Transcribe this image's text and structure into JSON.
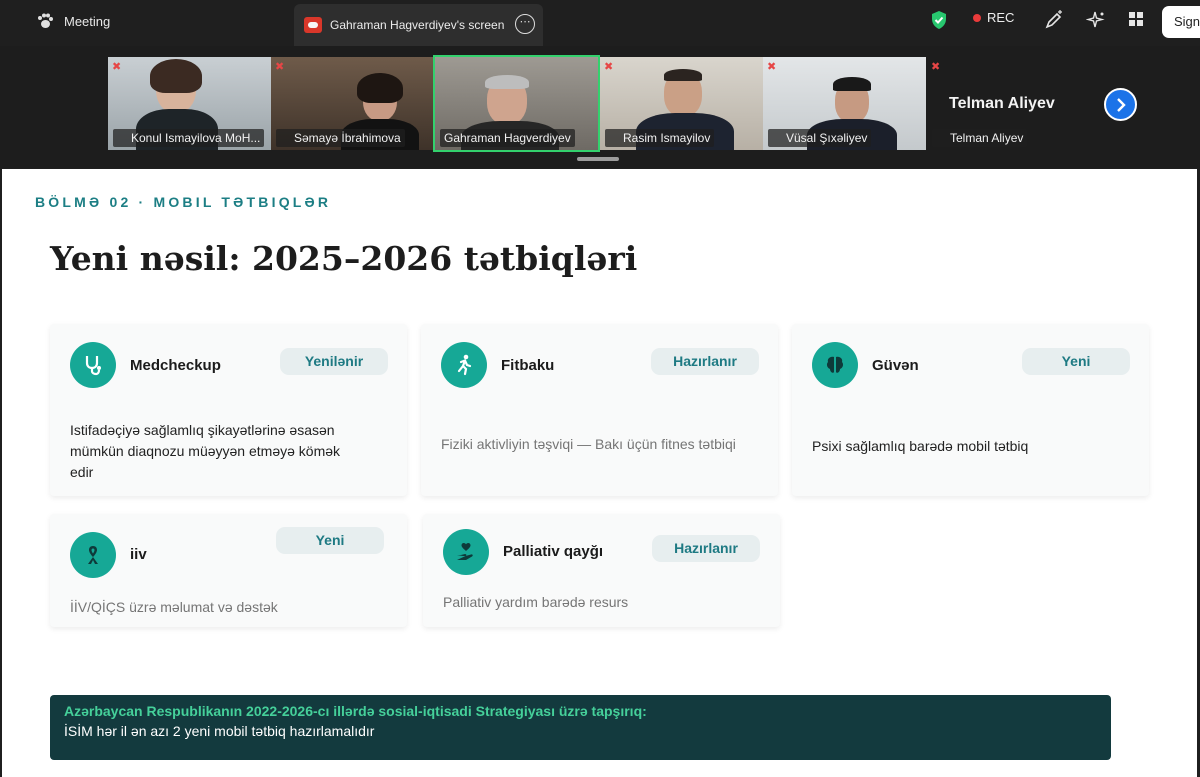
{
  "topbar": {
    "app_title": "Meeting",
    "share_tab_title": "Gahraman Hagverdiyev's screen",
    "more_symbol": "⋯",
    "rec_label": "REC",
    "sign_label": "Sign"
  },
  "participants": [
    {
      "name": "Konul Ismayilova MoH...",
      "active": false
    },
    {
      "name": "Səmayə İbrahimova",
      "active": false
    },
    {
      "name": "Gahraman Hagverdiyev",
      "active": true
    },
    {
      "name": "Rasim Ismayilov",
      "active": false
    },
    {
      "name": "Vüsal Şıxəliyev",
      "active": false
    },
    {
      "name": "Telman Aliyev",
      "active": false
    }
  ],
  "slide": {
    "section": "BÖLMƏ 02 · MOBIL TƏTBIQLƏR",
    "title": "Yeni nəsil: 2025–2026 tətbiqləri",
    "cards": [
      {
        "name": "Medcheckup",
        "status": "Yenilənir",
        "icon": "stethoscope-icon",
        "description": "Istifadəçiyə sağlamlıq şikayətlərinə əsasən mümkün diaqnozu müəyyən etməyə kömək edir"
      },
      {
        "name": "Fitbaku",
        "status": "Hazırlanır",
        "icon": "runner-icon",
        "description": "Fiziki aktivliyin təşviqi — Bakı üçün fitnes tətbiqi"
      },
      {
        "name": "Güvən",
        "status": "Yeni",
        "icon": "brain-icon",
        "description": "Psixi sağlamlıq barədə mobil tətbiq"
      },
      {
        "name": "iiv",
        "status": "Yeni",
        "icon": "ribbon-icon",
        "description": "İİV/QİÇS üzrə məlumat və dəstək"
      },
      {
        "name": "Palliativ qayğı",
        "status": "Hazırlanır",
        "icon": "care-hand-icon",
        "description": "Palliativ yardım barədə resurs"
      }
    ],
    "footer_heading": "Azərbaycan Respublikanın 2022-2026-cı illərdə sosial-iqtisadi  Strategiyası üzrə tapşırıq:",
    "footer_text": "İSİM hər il ən azı 2 yeni mobil tətbiq hazırlamalıdır"
  },
  "colors": {
    "accent_teal": "#16a896",
    "section_teal": "#1c7e84",
    "active_tile_border": "#33d16d",
    "footer_bg": "#133a3e",
    "footer_heading": "#45d09a"
  }
}
